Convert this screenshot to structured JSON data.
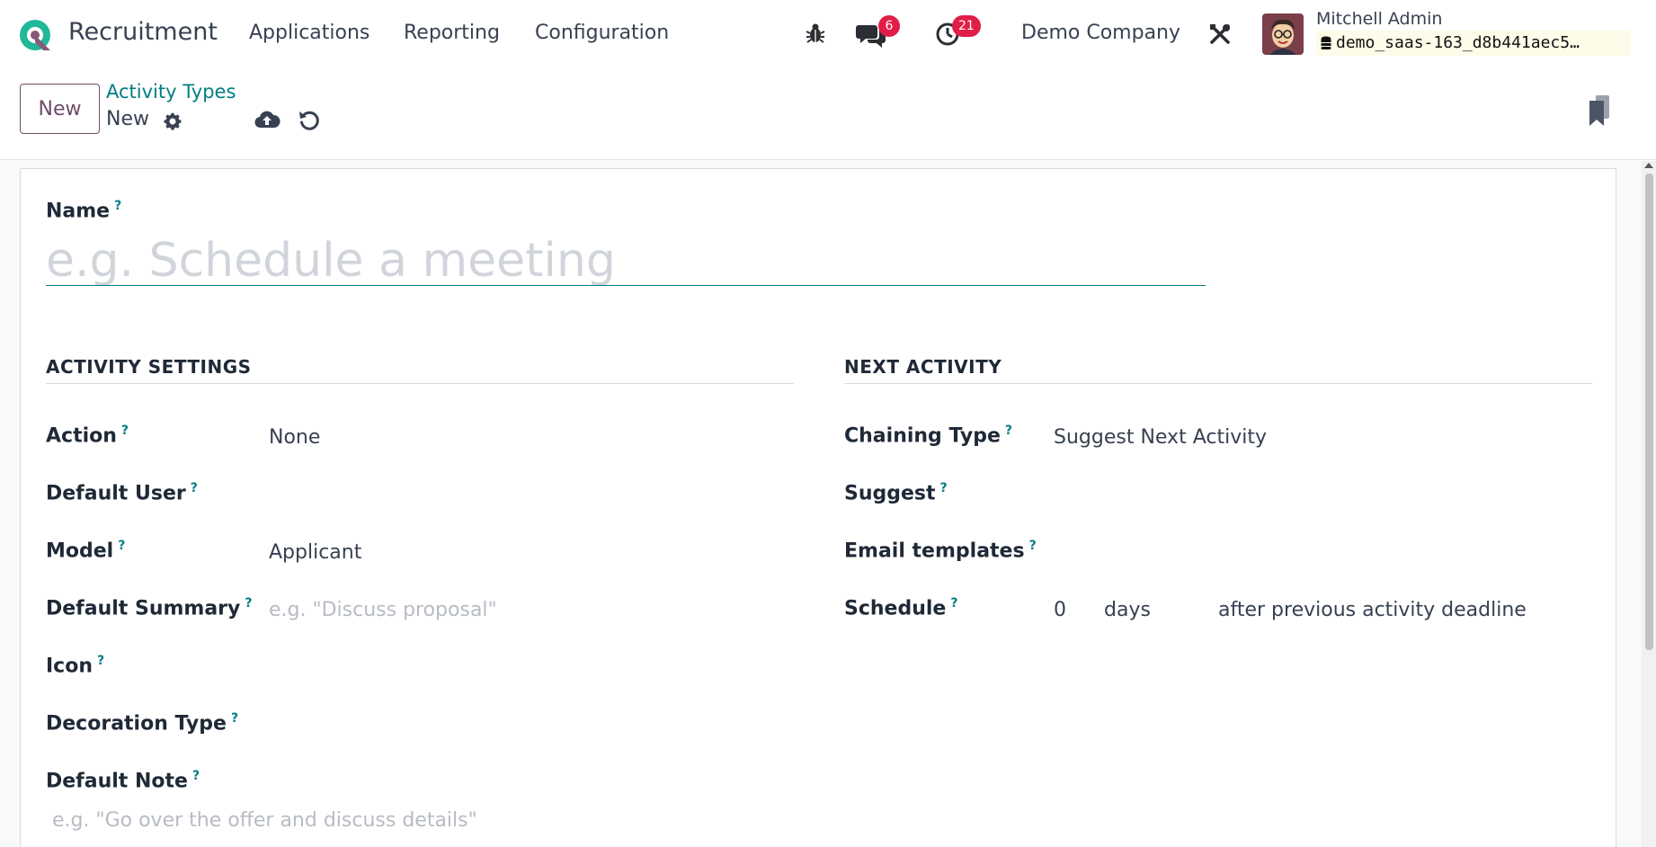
{
  "navbar": {
    "app_name": "Recruitment",
    "menu": [
      "Applications",
      "Reporting",
      "Configuration"
    ],
    "messages_count": "6",
    "activities_count": "21",
    "company": "Demo Company",
    "user_name": "Mitchell Admin",
    "database": "demo_saas-163_d8b441aec5…",
    "accent_color": "#714b67",
    "badge_color": "#e11d48"
  },
  "control": {
    "new_label": "New",
    "breadcrumb_parent": "Activity Types",
    "breadcrumb_current": "New"
  },
  "form": {
    "name_label": "Name",
    "name_placeholder": "e.g. Schedule a meeting",
    "activity_settings": {
      "title": "ACTIVITY SETTINGS",
      "action_label": "Action",
      "action_value": "None",
      "default_user_label": "Default User",
      "model_label": "Model",
      "model_value": "Applicant",
      "default_summary_label": "Default Summary",
      "default_summary_placeholder": "e.g. \"Discuss proposal\"",
      "icon_label": "Icon",
      "decoration_type_label": "Decoration Type",
      "default_note_label": "Default Note",
      "default_note_placeholder": "e.g. \"Go over the offer and discuss details\""
    },
    "next_activity": {
      "title": "NEXT ACTIVITY",
      "chaining_type_label": "Chaining Type",
      "chaining_type_value": "Suggest Next Activity",
      "suggest_label": "Suggest",
      "email_templates_label": "Email templates",
      "schedule_label": "Schedule",
      "schedule_count": "0",
      "schedule_unit": "days",
      "schedule_from": "after previous activity deadline"
    },
    "help_marker": "?"
  }
}
